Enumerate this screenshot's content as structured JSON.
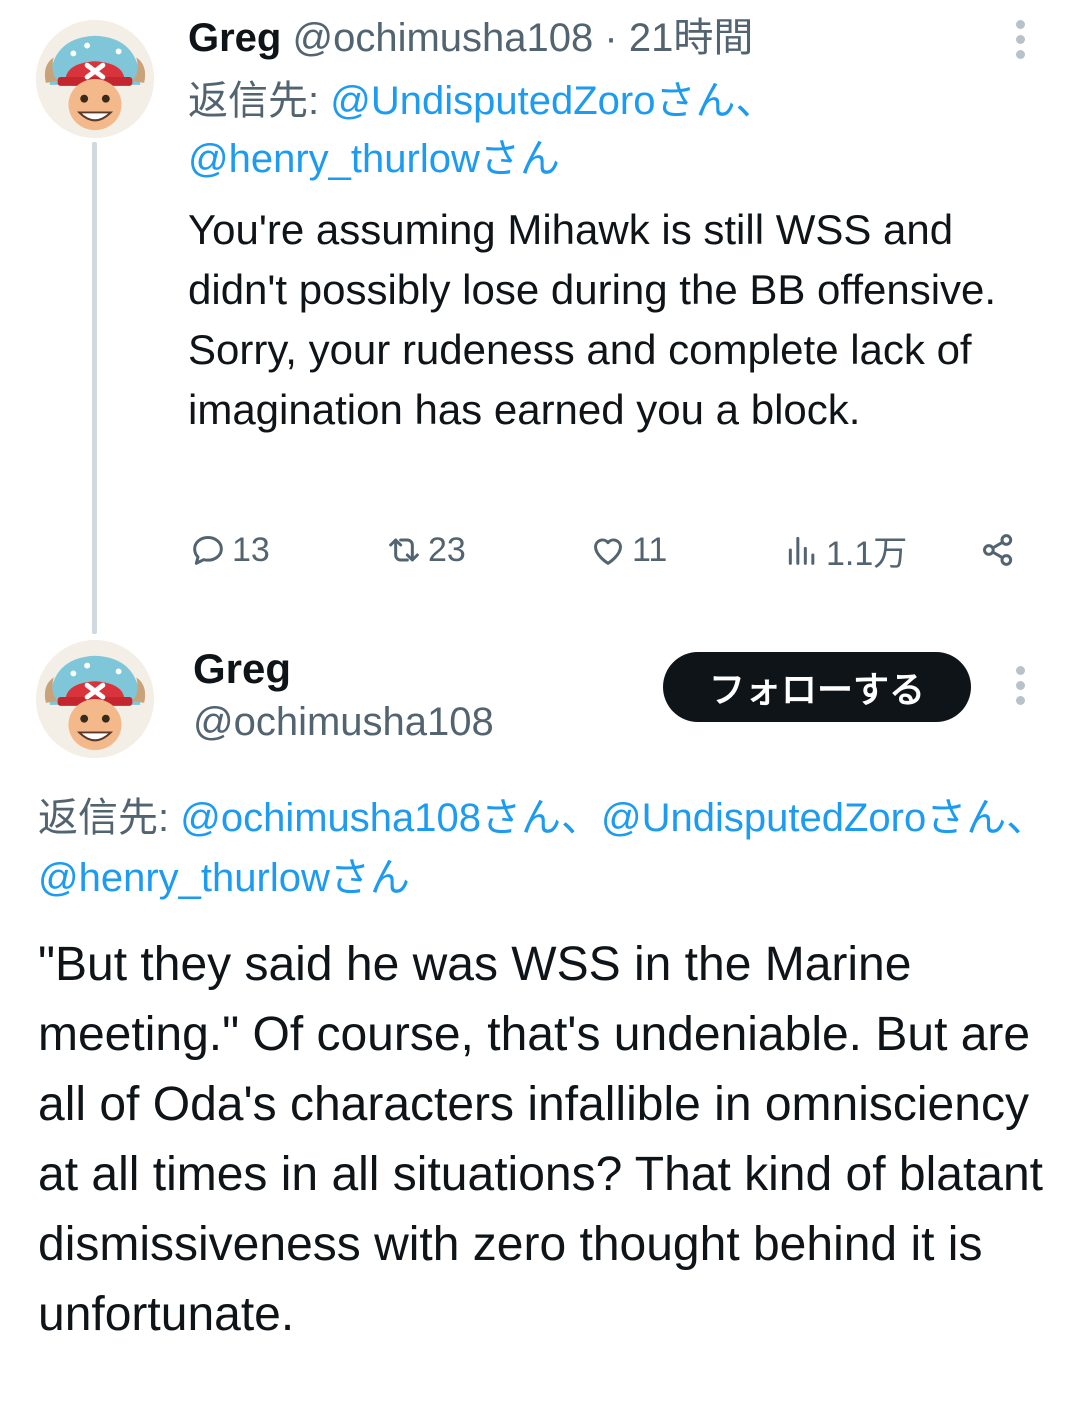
{
  "tweet1": {
    "name": "Greg",
    "handle": "@ochimusha108",
    "separator": "·",
    "time": "21時間",
    "reply_prefix": "返信先: ",
    "reply_mention_1": "@UndisputedZoro",
    "reply_suffix_1": "さん、",
    "reply_mention_2": "@henry_thurlow",
    "reply_suffix_2": "さん",
    "body": "You're assuming Mihawk is still WSS and didn't possibly lose during the BB offensive. Sorry, your rudeness and complete lack of imagination has earned you a block.",
    "actions": {
      "replies": "13",
      "reposts": "23",
      "likes": "11",
      "views": "1.1万"
    }
  },
  "tweet2": {
    "name": "Greg",
    "handle": "@ochimusha108",
    "follow_label": "フォローする",
    "reply_prefix": "返信先: ",
    "reply_mention_1": "@ochimusha108",
    "reply_suffix_1": "さん、",
    "reply_mention_2": "@UndisputedZoro",
    "reply_suffix_2": "さん、",
    "reply_mention_3": "@henry_thurlow",
    "reply_suffix_3": "さん",
    "body": "\"But they said he was WSS in the Marine meeting.\" Of course, that's undeniable. But are all of Oda's characters infallible in omnisciency at all times in all situations? That kind of blatant dismissiveness with zero thought behind it is unfortunate."
  },
  "colors": {
    "text": "#0f1419",
    "secondary": "#536471",
    "link": "#1d9bf0",
    "thread_line": "#cfd9de",
    "button_bg": "#0f1419"
  },
  "icons": [
    "avatar",
    "more-icon",
    "reply-icon",
    "repost-icon",
    "like-icon",
    "views-icon",
    "share-icon"
  ]
}
